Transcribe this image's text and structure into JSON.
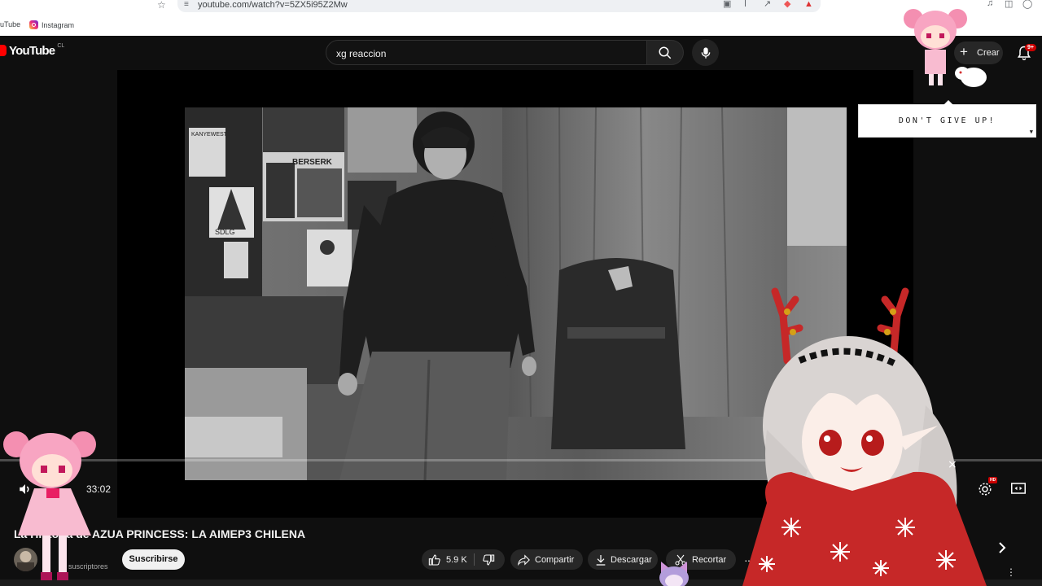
{
  "browser": {
    "url": "youtube.com/watch?v=5ZX5i95Z2Mw",
    "bookmarks": [
      {
        "label": "uTube"
      },
      {
        "label": "Instagram"
      }
    ]
  },
  "header": {
    "logo_text": "YouTube",
    "country_code": "CL",
    "search_value": "xg reaccion",
    "create_label": "Crear",
    "notifications_badge": "9+"
  },
  "player": {
    "time_display": "33:02",
    "quality_badge": "HD"
  },
  "video": {
    "title": "La Historia de AZUA PRINCESS: LA AIMEP3 CHILENA",
    "subscribers_label": "suscriptores",
    "subscribe_label": "Suscribirse",
    "likes": "5.9 K",
    "share_label": "Compartir",
    "download_label": "Descargar",
    "clip_label": "Recortar"
  },
  "overlay": {
    "speech_text": "DON'T GIVE UP!",
    "poster_labels": [
      "KANYEWEST",
      "BERSERK",
      "SDLG"
    ]
  },
  "colors": {
    "brand_red": "#ff0000",
    "background": "#0f0f0f",
    "pill": "#272727"
  }
}
